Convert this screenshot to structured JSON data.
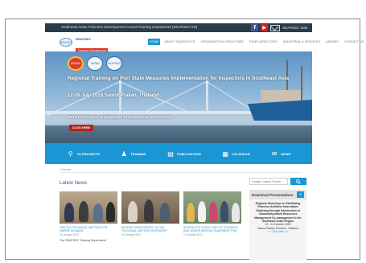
{
  "topbar": {
    "org_name": "Southeast Asian Fisheries Development Center/Training Department (SEAFDEC/TD)",
    "facebook_glyph": "f",
    "youtube_glyph": "▶",
    "mail_label": "SEAFDEC Mail"
  },
  "brand": {
    "logo_text": "SEAFDEC",
    "line1": "SEAFDEC",
    "line2": "Training Department"
  },
  "menu": [
    {
      "label": "HOME",
      "active": true
    },
    {
      "label": "ABOUT SEAFDEC/TD",
      "active": false
    },
    {
      "label": "ORGANIZATION STRUCTURE",
      "active": false
    },
    {
      "label": "STAFF DIRECTORY",
      "active": false
    },
    {
      "label": "INDUSTRIAL & SERVICES",
      "active": false
    },
    {
      "label": "LIBRARY",
      "active": false
    },
    {
      "label": "CONTACT US",
      "active": false
    }
  ],
  "hero": {
    "logos": [
      "ASEAN",
      "JAPAN",
      "SEAFDEC"
    ],
    "title": "Regional Training on Port State Measures Implementation for Inspectors in Southeast Asia",
    "subtitle": "22-26 July 2019,Samut Prakan, Thailand",
    "more_text": "More Information & Download Presentations and Photos",
    "button_label": "CLICK HERE"
  },
  "quicknav": [
    {
      "label": "TD PROJECTS",
      "icon": "map-pin-icon",
      "glyph": "⚲"
    },
    {
      "label": "TRAINING",
      "icon": "people-icon",
      "glyph": "♟"
    },
    {
      "label": "PUBLICATIONS",
      "icon": "book-icon",
      "glyph": "▤"
    },
    {
      "label": "CALENDAR",
      "icon": "calendar-icon",
      "glyph": "▦"
    },
    {
      "label": "NEWS",
      "icon": "news-icon",
      "glyph": "✉"
    }
  ],
  "breadcrumb": "< Home",
  "search": {
    "placeholder": "Google Custom Search"
  },
  "latest_news": {
    "heading": "Latest News",
    "items": [
      {
        "title": "ONE DAY TECHNICAL MEETING FOR MARINE BIOMASS",
        "date": "20 January 2020"
      },
      {
        "title": "SEAFDEC PARTICIPATED IN JICA TECHNICAL MEETING WORKSHOP",
        "date": "15 January 2020"
      },
      {
        "title": "SEAFDEC/TD STUDY VISIT OF STUDENTS AND SENIOR MEDICAL EQUIPMENT FOR HOSPITAL",
        "date": "10 January 2020"
      }
    ],
    "body_line": "The SEAFDEC Training Department"
  },
  "sidebar": {
    "title": "Download Presentations",
    "button_glyph": "»",
    "lines": [
      "Regional Workshop on Facilitating Fisheries Activities Information Gathering through Introduction of Community-based Resources Management Co-management in the Southeast Asian Region",
      "23 - 24 October 2019",
      "Samut Prakan Province, Thailand"
    ],
    "link": "<< Click Here >>"
  },
  "colors": {
    "accent": "#1b96d4",
    "topbar": "#2b3b47",
    "button_red": "#b3241e"
  }
}
